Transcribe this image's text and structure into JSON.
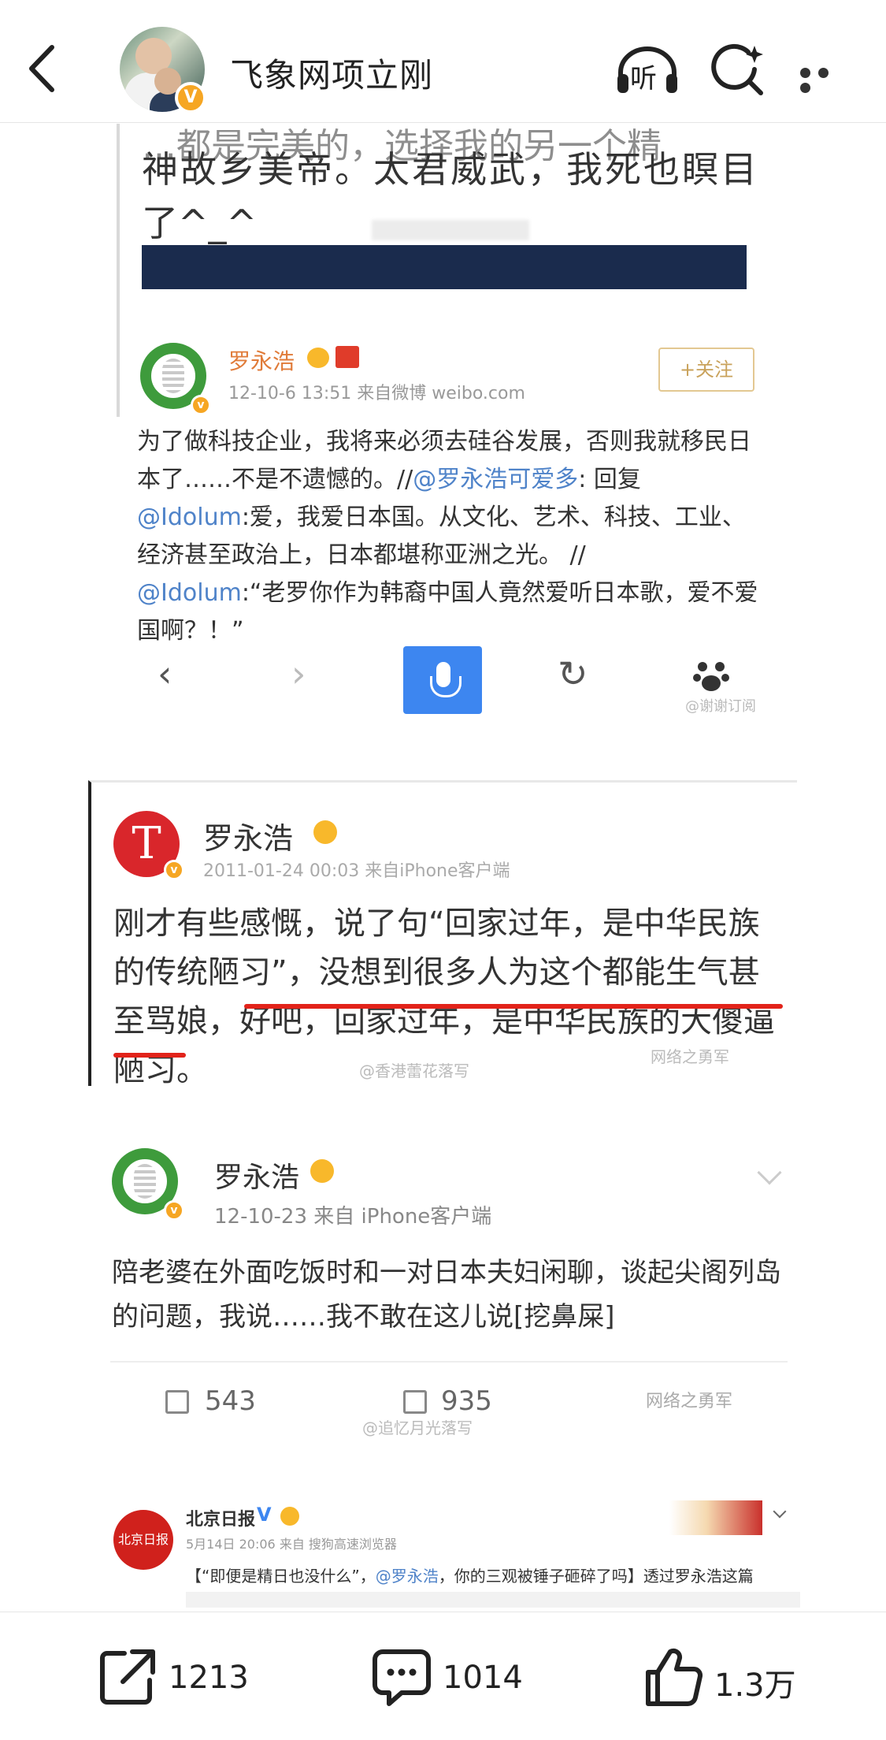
{
  "header": {
    "title": "飞象网项立刚",
    "listen_label": "听"
  },
  "block1": {
    "line0": "…都是完美的，选择我的另一个精",
    "line1": "神故乡美帝。太君威武，我死也瞑目",
    "line2": "了^_^"
  },
  "post_a": {
    "name": "罗永浩",
    "meta": "12-10-6 13:51  来自微博 weibo.com",
    "follow_label": "+关注",
    "text_1": "为了做科技企业，我将来必须去硅谷发展，否则我就移民日本了……不是不遗憾的。//",
    "mention_1": "@罗永浩可爱多",
    "text_2": ": 回复",
    "mention_2": "@Idolum",
    "text_3": ":爱，我爱日本国。从文化、艺术、科技、工业、经济甚至政治上，日本都堪称亚洲之光。 //",
    "mention_3": "@Idolum",
    "text_4": ":“老罗你作为韩裔中国人竟然爱听日本歌，爱不爱国啊？！”"
  },
  "browser_bar": {
    "back": "‹",
    "forward": "›",
    "refresh": "↻",
    "watermark": "@谢谢订阅"
  },
  "post_b": {
    "avatar_letter": "T",
    "name": "罗永浩",
    "meta": "2011-01-24 00:03  来自iPhone客户端",
    "text_normal": "刚才有些感慨，说了句“回家过年，是中华民族的传统陋习”，没想到很多人为这个都能生气甚至骂娘，",
    "text_underlined": "好吧，回家过年，是中华民族的大傻逼陋习。",
    "watermark_1": "@香港蕾花落写",
    "watermark_2": "网络之勇军"
  },
  "post_c": {
    "name": "罗永浩",
    "meta": "12-10-23  来自 iPhone客户端",
    "text": "陪老婆在外面吃饭时和一对日本夫妇闲聊，谈起尖阁列岛的问题，我说……我不敢在这儿说[挖鼻屎]",
    "reposts": "543",
    "comments": "935",
    "watermark_1": "@追忆月光落写",
    "watermark_2": "网络之勇军"
  },
  "post_d": {
    "avatar_text": "北京日报",
    "name": "北京日报",
    "verified": "V",
    "meta": "5月14日 20:06 来自 搜狗高速浏览器",
    "text_1": "【“即便是精日也没什么”，",
    "mention": "@罗永浩",
    "text_2": "，你的三观被锤子砸碎了吗】透过罗永浩这篇"
  },
  "bottom_bar": {
    "share_count": "1213",
    "comment_count": "1014",
    "like_count": "1.3万"
  }
}
